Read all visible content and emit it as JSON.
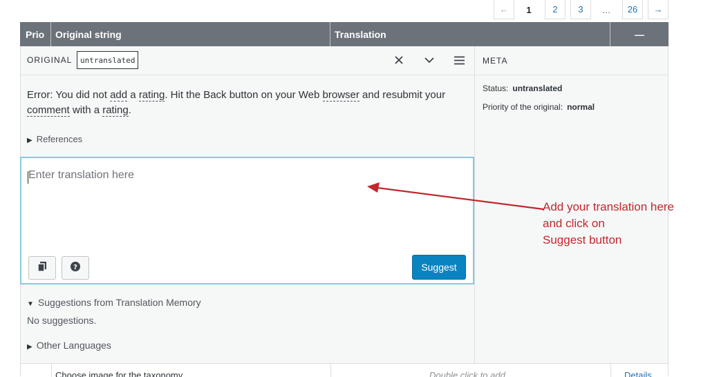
{
  "pagination": {
    "prev": "←",
    "pages": [
      "1",
      "2",
      "3"
    ],
    "ellipsis": "…",
    "last": "26",
    "next": "→"
  },
  "table_header": {
    "prio": "Prio",
    "original": "Original string",
    "translation": "Translation",
    "collapse": "—"
  },
  "editor": {
    "original_label": "ORIGINAL",
    "status_tag": "untranslated",
    "original_text": {
      "part1": "Error: You did not ",
      "add": "add",
      "part2": " a ",
      "rating1": "rating",
      "part3": ". Hit the Back button on your Web ",
      "browser": "browser",
      "part4": " and resubmit your ",
      "comment": "comment",
      "part5": " with a ",
      "rating2": "rating",
      "part6": "."
    },
    "references": "References",
    "translation_placeholder": "Enter translation here",
    "suggest_button": "Suggest",
    "suggestions_title": "Suggestions from Translation Memory",
    "suggestions_empty": "No suggestions.",
    "other_languages": "Other Languages",
    "icons": {
      "close": "close-icon",
      "collapse": "chevron-down-icon",
      "menu": "menu-icon",
      "copy": "copy-original-icon",
      "help": "help-icon"
    }
  },
  "meta": {
    "title": "META",
    "status_label": "Status:",
    "status_value": "untranslated",
    "priority_label": "Priority of the original:",
    "priority_value": "normal"
  },
  "next_row": {
    "original": "Choose image for the taxonomy",
    "translation": "Double click to add",
    "details": "Details"
  },
  "annotation": {
    "line1": "Add your translation here",
    "line2": "and click on",
    "line3": "Suggest button",
    "color": "#c0282d"
  },
  "colors": {
    "header_bg": "#6b7279",
    "suggest_button": "#0a84c1",
    "focus_border": "#8ac8dc"
  }
}
